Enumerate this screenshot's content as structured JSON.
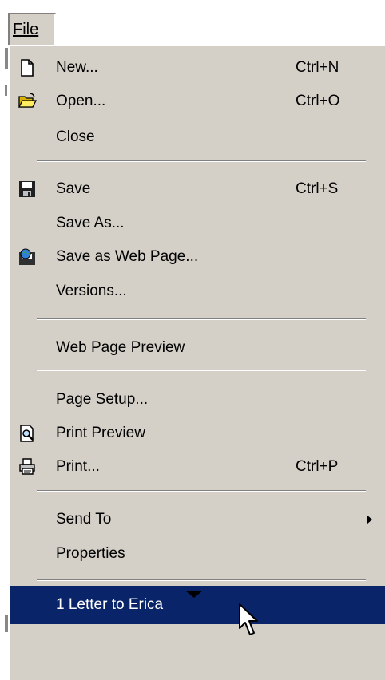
{
  "menu": {
    "title": "File",
    "items": [
      {
        "label": "New...",
        "shortcut": "Ctrl+N",
        "icon": "new-document-icon"
      },
      {
        "label": "Open...",
        "shortcut": "Ctrl+O",
        "icon": "open-folder-icon"
      },
      {
        "label": "Close",
        "shortcut": ""
      },
      {
        "label": "Save",
        "shortcut": "Ctrl+S",
        "icon": "save-floppy-icon"
      },
      {
        "label": "Save As...",
        "shortcut": ""
      },
      {
        "label": "Save as Web Page...",
        "shortcut": "",
        "icon": "web-page-icon"
      },
      {
        "label": "Versions...",
        "shortcut": ""
      },
      {
        "label": "Web Page Preview",
        "shortcut": ""
      },
      {
        "label": "Page Setup...",
        "shortcut": ""
      },
      {
        "label": "Print Preview",
        "shortcut": "",
        "icon": "print-preview-icon"
      },
      {
        "label": "Print...",
        "shortcut": "Ctrl+P",
        "icon": "printer-icon"
      },
      {
        "label": "Send To",
        "shortcut": "",
        "submenu": true
      },
      {
        "label": "Properties",
        "shortcut": ""
      },
      {
        "label": "1 Letter to Erica",
        "shortcut": "",
        "highlighted": true
      }
    ],
    "expand_icon": "chevron-down-icon",
    "highlight_color": "#0a246a",
    "menu_background": "#d4d0c8"
  }
}
